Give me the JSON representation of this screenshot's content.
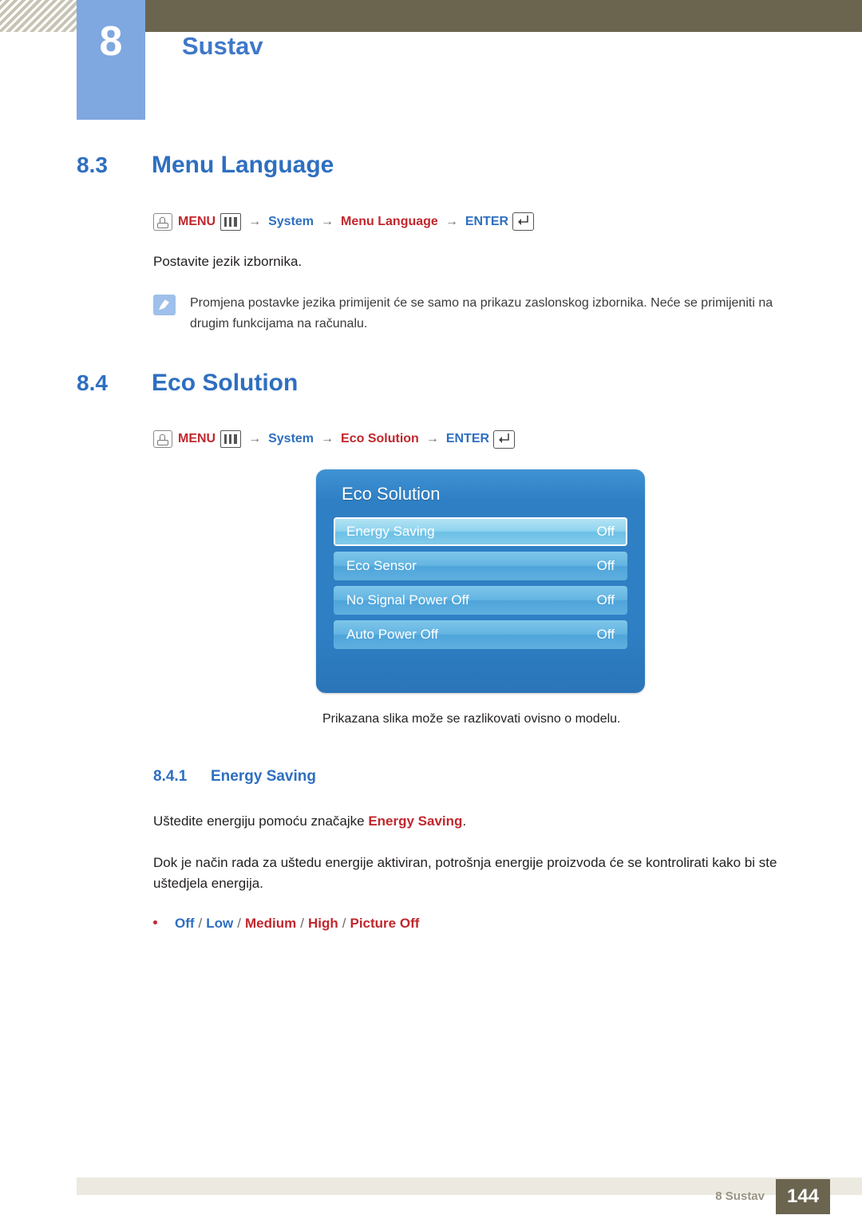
{
  "header": {
    "chapter_number": "8",
    "chapter_title": "Sustav"
  },
  "sections": [
    {
      "number": "8.3",
      "title": "Menu Language",
      "menu_path": {
        "menu_label": "MENU",
        "arrow": "→",
        "item1": "System",
        "item2": "Menu Language",
        "enter_label": "ENTER"
      },
      "paragraph": "Postavite jezik izbornika.",
      "note": "Promjena postavke jezika primijenit će se samo na prikazu zaslonskog izbornika. Neće se primijeniti na drugim funkcijama na računalu."
    },
    {
      "number": "8.4",
      "title": "Eco Solution",
      "menu_path": {
        "menu_label": "MENU",
        "arrow": "→",
        "item1": "System",
        "item2": "Eco Solution",
        "enter_label": "ENTER"
      }
    }
  ],
  "osd": {
    "title": "Eco Solution",
    "rows": [
      {
        "label": "Energy Saving",
        "value": "Off",
        "selected": true
      },
      {
        "label": "Eco Sensor",
        "value": "Off",
        "selected": false
      },
      {
        "label": "No Signal Power Off",
        "value": "Off",
        "selected": false
      },
      {
        "label": "Auto Power Off",
        "value": "Off",
        "selected": false
      }
    ],
    "caption": "Prikazana slika može se razlikovati ovisno o modelu."
  },
  "subsection": {
    "number": "8.4.1",
    "title": "Energy Saving",
    "para1_before": "Uštedite energiju pomoću značajke ",
    "para1_red": "Energy Saving",
    "para1_after": ".",
    "para2": "Dok je način rada za uštedu energije aktiviran, potrošnja energije proizvoda će se kontrolirati kako bi ste uštedjela energija.",
    "options": {
      "opt1": "Off",
      "opt2": "Low",
      "opt3": "Medium",
      "opt4": "High",
      "opt5": "Picture Off",
      "separator": "/"
    }
  },
  "footer": {
    "label": "8 Sustav",
    "page": "144"
  },
  "colors": {
    "accent_blue": "#2e6fc0",
    "accent_red": "#c1272d",
    "header_bar": "#6b6550",
    "badge_blue": "#7fa7e0"
  }
}
